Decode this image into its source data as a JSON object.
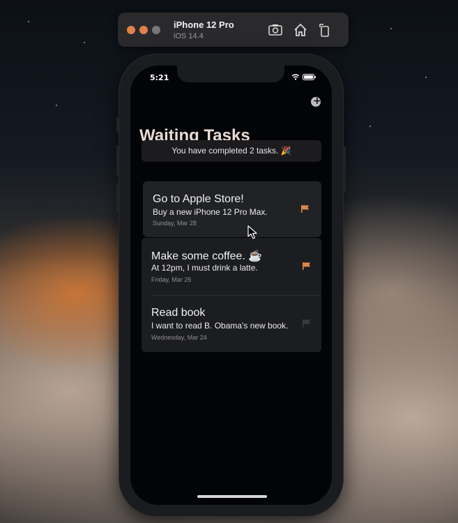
{
  "simulator": {
    "device_name": "iPhone 12 Pro",
    "os_version": "iOS 14.4"
  },
  "status_bar": {
    "time": "5:21"
  },
  "app": {
    "title": "Waiting Tasks",
    "completed_message": "You have completed 2 tasks. 🎉"
  },
  "tasks": [
    {
      "title": "Go to Apple Store!",
      "description": "Buy a new iPhone 12 Pro Max.",
      "date": "Sunday, Mar 28",
      "flagged": true
    },
    {
      "title": "Make some coffee. ☕",
      "description": "At 12pm, I must drink a latte.",
      "date": "Friday, Mar 26",
      "flagged": true
    },
    {
      "title": "Read book",
      "description": "I want to read B. Obama's new book.",
      "date": "Wednesday, Mar 24",
      "flagged": false
    }
  ],
  "colors": {
    "accent_flag": "#e0874a",
    "muted_flag": "#3a3b3f",
    "title_color": "#e9d9d4"
  },
  "icons": {
    "add": "plus-circle-icon",
    "screenshot": "camera-icon",
    "home": "home-icon",
    "rotate": "rotate-icon"
  }
}
